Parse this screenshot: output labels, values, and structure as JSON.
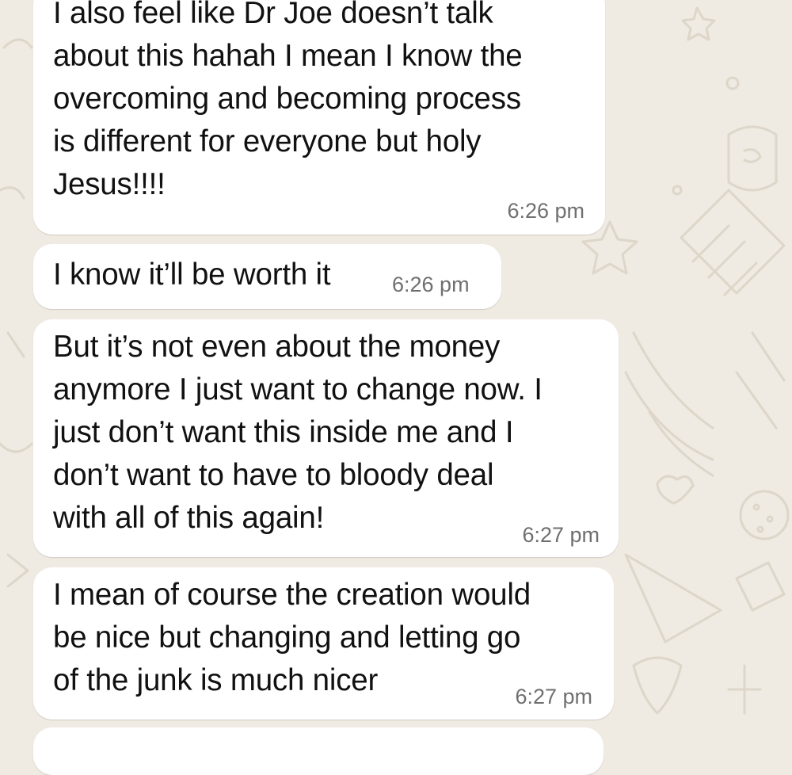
{
  "chat": {
    "background_color": "#efeae2",
    "bubble_color": "#ffffff",
    "messages": [
      {
        "text": "I also feel like Dr Joe doesn’t talk\nabout this hahah I mean I know the\novercoming and becoming process\nis different for everyone but holy\nJesus!!!!",
        "time": "6:26 pm"
      },
      {
        "text": "I know it’ll be worth it",
        "time": "6:26 pm"
      },
      {
        "text": "But it’s not even about the money\nanymore I just want to change now. I\njust don’t want this inside me and I\ndon’t want to have to bloody deal\nwith all of this again!",
        "time": "6:27 pm"
      },
      {
        "text": "I mean of course the creation would\nbe nice but changing and letting go\nof the junk is much nicer",
        "time": "6:27 pm"
      }
    ]
  }
}
